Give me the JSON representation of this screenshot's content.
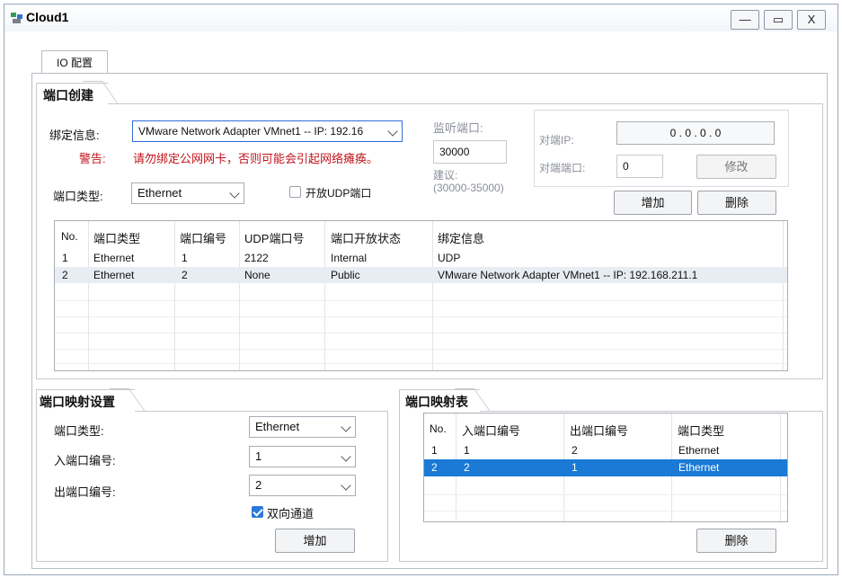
{
  "window": {
    "title": "Cloud1",
    "minimize": "—",
    "maximize": "▭",
    "close": "X"
  },
  "tabs": [
    {
      "label": "IO 配置"
    }
  ],
  "port_creation": {
    "title": "端口创建",
    "binding_label": "绑定信息:",
    "binding_value": "VMware Network Adapter VMnet1 -- IP: 192.16",
    "warning_label": "警告:",
    "warning_text": "请勿绑定公网网卡，否则可能会引起网络瘫痪。",
    "port_type_label": "端口类型:",
    "port_type_value": "Ethernet",
    "udp_checkbox_label": "开放UDP端口",
    "listen_port_label": "监听端口:",
    "listen_port_value": "30000",
    "suggest_label": "建议:",
    "suggest_range": "(30000-35000)",
    "peer_ip_label": "对端IP:",
    "peer_ip_value": "0  .  0  .  0  .  0",
    "peer_port_label": "对端端口:",
    "peer_port_value": "0",
    "modify_button": "修改",
    "add_button": "增加",
    "delete_button": "删除",
    "table": {
      "headers": [
        "No.",
        "端口类型",
        "端口编号",
        "UDP端口号",
        "端口开放状态",
        "绑定信息"
      ],
      "rows": [
        [
          "1",
          "Ethernet",
          "1",
          "2122",
          "Internal",
          "UDP"
        ],
        [
          "2",
          "Ethernet",
          "2",
          "None",
          "Public",
          "VMware Network Adapter VMnet1 -- IP: 192.168.211.1"
        ]
      ]
    }
  },
  "port_mapping_settings": {
    "title": "端口映射设置",
    "port_type_label": "端口类型:",
    "port_type_value": "Ethernet",
    "in_port_label": "入端口编号:",
    "in_port_value": "1",
    "out_port_label": "出端口编号:",
    "out_port_value": "2",
    "bidirectional_label": "双向通道",
    "add_button": "增加"
  },
  "port_mapping_table": {
    "title": "端口映射表",
    "headers": [
      "No.",
      "入端口编号",
      "出端口编号",
      "端口类型"
    ],
    "rows": [
      [
        "1",
        "1",
        "2",
        "Ethernet"
      ],
      [
        "2",
        "2",
        "1",
        "Ethernet"
      ]
    ],
    "delete_button": "删除"
  },
  "colors": {
    "selected_row": "#1a7ad6",
    "warning": "#c0141c",
    "row_highlight": "#e8edf3"
  }
}
